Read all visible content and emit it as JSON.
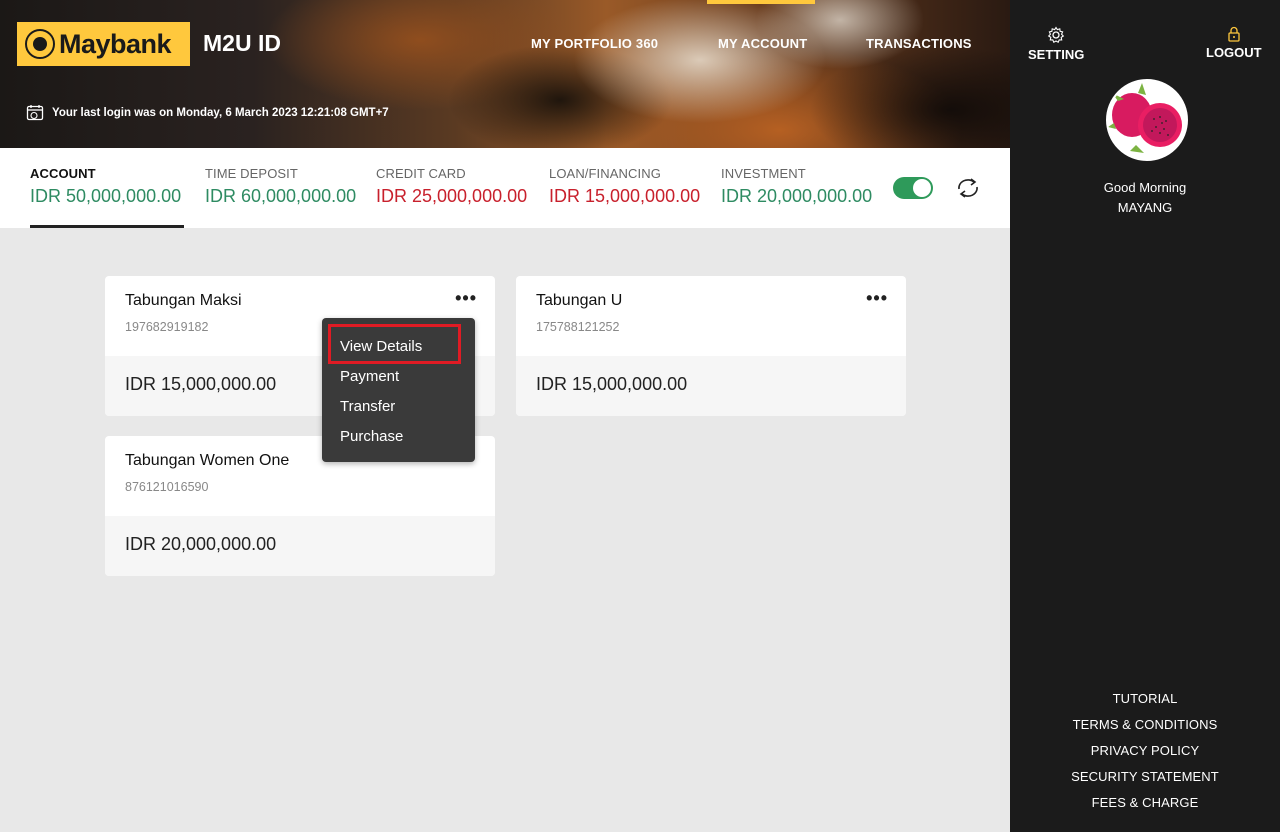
{
  "header": {
    "logo_text": "Maybank",
    "app_title": "M2U ID",
    "nav": [
      "MY PORTFOLIO 360",
      "MY ACCOUNT",
      "TRANSACTIONS"
    ],
    "last_login": "Your last login was on Monday, 6 March 2023 12:21:08 GMT+7"
  },
  "sidebar": {
    "setting_label": "SETTING",
    "logout_label": "LOGOUT",
    "greeting": "Good Morning",
    "user_name": "MAYANG",
    "footer_links": [
      "TUTORIAL",
      "TERMS & CONDITIONS",
      "PRIVACY POLICY",
      "SECURITY STATEMENT",
      "FEES & CHARGE"
    ]
  },
  "summary": {
    "items": [
      {
        "label": "ACCOUNT",
        "value": "IDR 50,000,000.00"
      },
      {
        "label": "TIME DEPOSIT",
        "value": "IDR 60,000,000.00"
      },
      {
        "label": "CREDIT CARD",
        "value": "IDR 25,000,000.00"
      },
      {
        "label": "LOAN/FINANCING",
        "value": "IDR 15,000,000.00"
      },
      {
        "label": "INVESTMENT",
        "value": "IDR 20,000,000.00"
      }
    ]
  },
  "accounts": [
    {
      "name": "Tabungan Maksi",
      "number": "197682919182",
      "balance": "IDR 15,000,000.00"
    },
    {
      "name": "Tabungan U",
      "number": "175788121252",
      "balance": "IDR 15,000,000.00"
    },
    {
      "name": "Tabungan Women One",
      "number": "876121016590",
      "balance": "IDR 20,000,000.00"
    }
  ],
  "menu": {
    "items": [
      "View Details",
      "Payment",
      "Transfer",
      "Purchase"
    ]
  },
  "colors": {
    "brand_yellow": "#ffc83d",
    "positive_green": "#2e8b62",
    "negative_red": "#c8202c",
    "highlight_red": "#e01b24",
    "sidebar_bg": "#1b1b1b"
  }
}
